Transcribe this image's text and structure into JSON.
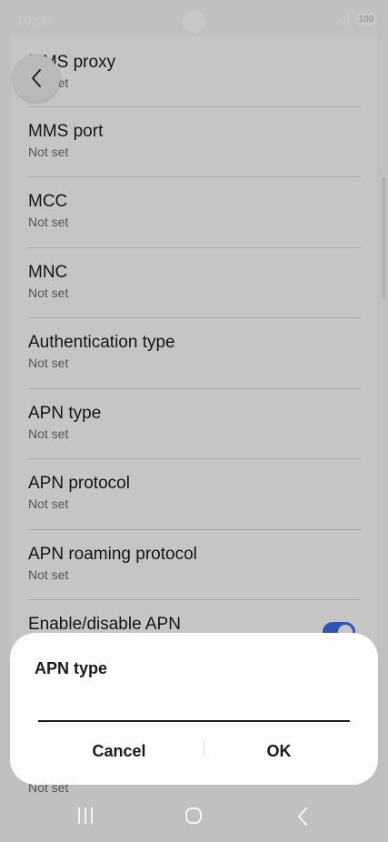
{
  "status_bar": {
    "time": "10:00",
    "battery": "100"
  },
  "items": [
    {
      "title": "MMS proxy",
      "subtitle": "Not set"
    },
    {
      "title": "MMS port",
      "subtitle": "Not set"
    },
    {
      "title": "MCC",
      "subtitle": "Not set"
    },
    {
      "title": "MNC",
      "subtitle": "Not set"
    },
    {
      "title": "Authentication type",
      "subtitle": "Not set"
    },
    {
      "title": "APN type",
      "subtitle": "Not set"
    },
    {
      "title": "APN protocol",
      "subtitle": "Not set"
    },
    {
      "title": "APN roaming protocol",
      "subtitle": "Not set"
    },
    {
      "title": "Enable/disable APN",
      "subtitle": ""
    }
  ],
  "bottom_subtitle": "Not set",
  "dialog": {
    "title": "APN type",
    "value": "",
    "cancel_label": "Cancel",
    "ok_label": "OK"
  },
  "icons": {
    "back": "chevron-left-icon",
    "nav_recents": "recents-icon",
    "nav_home": "home-icon",
    "nav_back": "nav-back-icon",
    "signal": "signal-icon",
    "battery": "battery-icon"
  }
}
